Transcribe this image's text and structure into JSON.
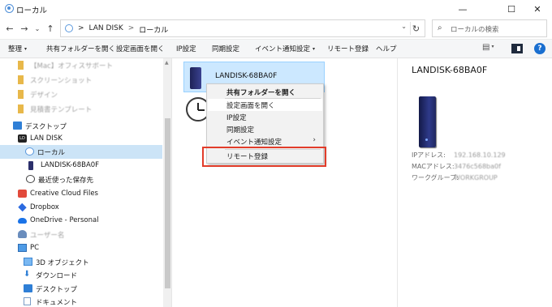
{
  "window": {
    "title": "ローカル",
    "minimize": "—",
    "maximize": "☐",
    "close": "✕"
  },
  "address": {
    "back": "←",
    "forward": "→",
    "recent": "⌄",
    "up": "↑",
    "crumbs": [
      "LAN DISK",
      "ローカル"
    ],
    "separator": ">",
    "dropdown": "⌄",
    "refresh": "↻",
    "search_icon": "⌕",
    "search_placeholder": "ローカルの検索"
  },
  "toolbar": {
    "organize": "整理",
    "open_shared_folder": "共有フォルダーを開く",
    "open_settings": "設定画面を開く",
    "ip_settings": "IP設定",
    "sync_settings": "同期設定",
    "event_notify": "イベント通知設定",
    "remote_register": "リモート登録",
    "help": "ヘルプ",
    "caret": "▾",
    "help_icon": "?"
  },
  "nav": {
    "items": [
      {
        "label": "【Mac】オフィスサポート",
        "icon": "folder-pin-icon",
        "blur": true
      },
      {
        "label": "スクリーンショット",
        "icon": "folder-pin-icon",
        "blur": true
      },
      {
        "label": "デザイン",
        "icon": "folder-pin-icon",
        "blur": true
      },
      {
        "label": "見積書テンプレート",
        "icon": "folder-pin-icon",
        "blur": true
      },
      {
        "label": "デスクトップ",
        "icon": "desktop-icon"
      },
      {
        "label": "LAN DISK",
        "icon": "lan-disk-icon",
        "icon_text": "LD"
      },
      {
        "label": "ローカル",
        "icon": "local-icon",
        "selected": true
      },
      {
        "label": "LANDISK-68BA0F",
        "icon": "device-icon"
      },
      {
        "label": "最近使った保存先",
        "icon": "clock-icon"
      },
      {
        "label": "Creative Cloud Files",
        "icon": "creative-cloud-icon"
      },
      {
        "label": "Dropbox",
        "icon": "dropbox-icon"
      },
      {
        "label": "OneDrive - Personal",
        "icon": "onedrive-icon"
      },
      {
        "label": "ユーザー名",
        "icon": "user-icon",
        "blur": true
      },
      {
        "label": "PC",
        "icon": "pc-icon"
      },
      {
        "label": "3D オブジェクト",
        "icon": "3d-objects-icon"
      },
      {
        "label": "ダウンロード",
        "icon": "download-icon",
        "icon_text": "⬇"
      },
      {
        "label": "デスクトップ",
        "icon": "desktop-icon"
      },
      {
        "label": "ドキュメント",
        "icon": "documents-icon"
      }
    ]
  },
  "content": {
    "device_name": "LANDISK-68BA0F"
  },
  "context_menu": {
    "items": [
      {
        "label": "共有フォルダーを開く",
        "bold": true
      },
      {
        "label": "設定画面を開く",
        "hover": true
      },
      {
        "label": "IP設定"
      },
      {
        "label": "同期設定"
      },
      {
        "label": "イベント通知設定",
        "submenu": true
      },
      {
        "label": "リモート登録",
        "highlighted": true
      }
    ],
    "submenu_arrow": "›"
  },
  "details": {
    "title": "LANDISK-68BA0F",
    "rows": [
      {
        "key": "IPアドレス:",
        "value": "192.168.10.129"
      },
      {
        "key": "MACアドレス:",
        "value": "3476c568ba0f"
      },
      {
        "key": "ワークグループ:",
        "value": "WORKGROUP"
      }
    ]
  },
  "colors": {
    "selection": "#cce8ff",
    "highlight_border": "#e23c2a",
    "help_blue": "#1a6fd0"
  }
}
